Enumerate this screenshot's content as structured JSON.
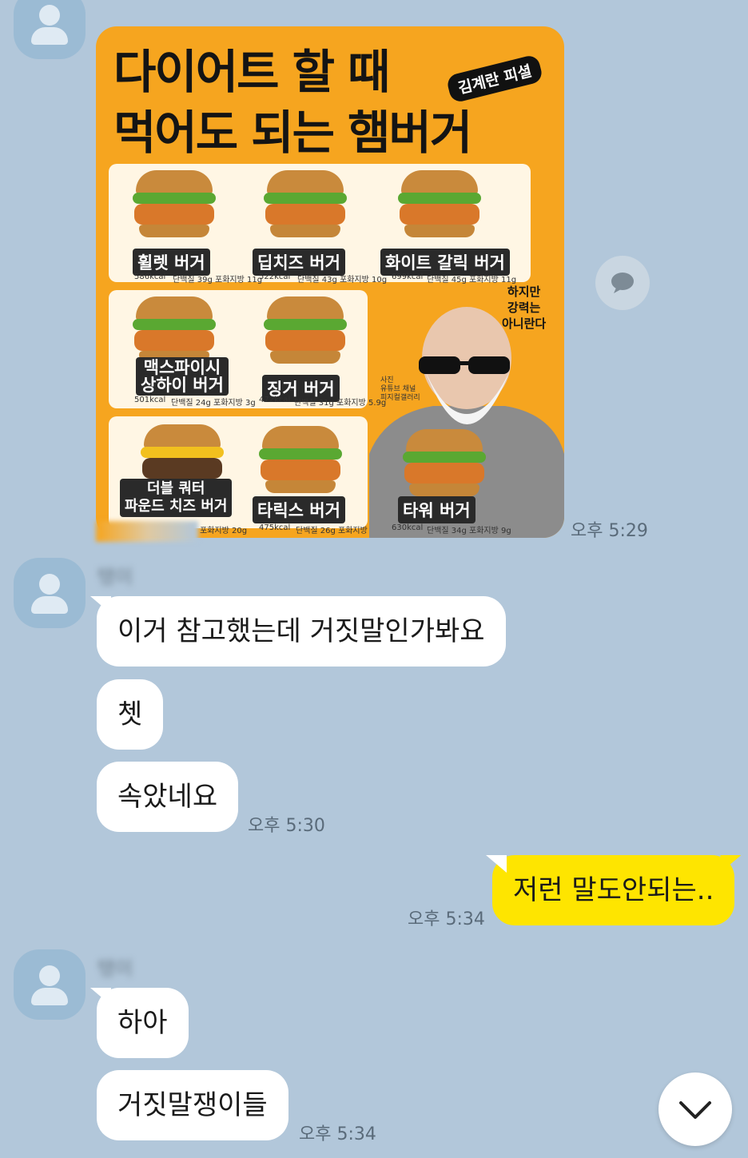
{
  "messages": [
    {
      "sender_name": "탱이",
      "type": "image",
      "time": "오후 5:29"
    },
    {
      "sender_name": "탱이",
      "text": "이거 참고했는데 거짓말인가봐요"
    },
    {
      "text": "쳇"
    },
    {
      "text": "속았네요",
      "time": "오후 5:30"
    },
    {
      "side": "me",
      "text": "저런 말도안되는..",
      "time": "오후 5:34"
    },
    {
      "sender_name": "탱이",
      "text": "하아"
    },
    {
      "text": "거짓말쟁이들",
      "time": "오후 5:34"
    }
  ],
  "image": {
    "headline_line1": "다이어트 할 때",
    "headline_line2": "먹어도 되는 햄버거",
    "stamp": "김계란 피셜",
    "side_caption": "하지만\n강력는\n아니란다",
    "photo_credit": "사진\n유튜브 채널\n피지컬갤러리",
    "burgers": [
      {
        "name": "휠렛 버거",
        "kcal": "586kcal",
        "detail": "단백질 39g 포화지방 11g"
      },
      {
        "name": "딥치즈 버거",
        "kcal": "522kcal",
        "detail": "단백질 43g 포화지방 10g"
      },
      {
        "name": "화이트 갈릭 버거",
        "kcal": "699kcal",
        "detail": "단백질 45g 포화지방 11g"
      },
      {
        "name": "맥스파이시\n상하이 버거",
        "kcal": "501kcal",
        "detail": "단백질 24g 포화지방 3g"
      },
      {
        "name": "징거 버거",
        "kcal": "472kcal",
        "detail": "단백질 31g 포화지방 5.9g"
      },
      {
        "name": "더블 쿼터\n파운드 치즈 버거",
        "kcal": "",
        "detail": "포화지방 20g"
      },
      {
        "name": "타릭스 버거",
        "kcal": "475kcal",
        "detail": "단백질 26g 포화지방 5.4g"
      },
      {
        "name": "타워 버거",
        "kcal": "630kcal",
        "detail": "단백질 34g 포화지방 9g"
      }
    ]
  },
  "icons": {
    "chat": "chat-bubble-icon",
    "scroll": "chevron-down-icon"
  },
  "colors": {
    "background": "#b2c7da",
    "my_bubble": "#fee500",
    "their_bubble": "#ffffff",
    "image_bg": "#f6a51f"
  }
}
